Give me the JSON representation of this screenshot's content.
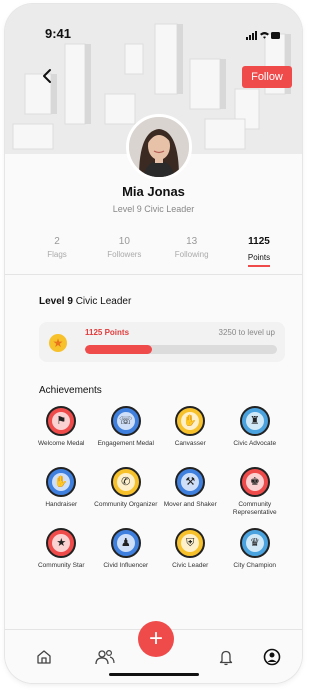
{
  "status_bar": {
    "time": "9:41"
  },
  "header": {
    "follow_label": "Follow"
  },
  "profile": {
    "name": "Mia Jonas",
    "level_title": "Level 9 Civic Leader"
  },
  "stats": [
    {
      "value": "2",
      "label": "Flags"
    },
    {
      "value": "10",
      "label": "Followers"
    },
    {
      "value": "13",
      "label": "Following"
    },
    {
      "value": "1125",
      "label": "Points"
    }
  ],
  "level_section": {
    "title_bold": "Level 9",
    "title_rest": " Civic Leader",
    "points_text": "1125 Points",
    "level_up_text": "3250 to level up",
    "progress_fraction": 0.35
  },
  "achievements": {
    "title": "Achievements",
    "items": [
      {
        "label": "Welcome Medal",
        "icon": "flag-icon",
        "color": "#ef4b4b"
      },
      {
        "label": "Engagement Medal",
        "icon": "phone-icon",
        "color": "#3f7fdd"
      },
      {
        "label": "Canvasser",
        "icon": "handshake-icon",
        "color": "#f7c12c"
      },
      {
        "label": "Civic Advocate",
        "icon": "podium-icon",
        "color": "#4aa3df"
      },
      {
        "label": "Handraiser",
        "icon": "hand-icon",
        "color": "#3f7fdd"
      },
      {
        "label": "Community Organizer",
        "icon": "megaphone-icon",
        "color": "#f7c12c"
      },
      {
        "label": "Mover and Shaker",
        "icon": "hammer-icon",
        "color": "#3f7fdd"
      },
      {
        "label": "Community Representative",
        "icon": "speaker-icon",
        "color": "#ef4b4b"
      },
      {
        "label": "Community Star",
        "icon": "star-icon",
        "color": "#ef4b4b"
      },
      {
        "label": "Civid Influencer",
        "icon": "person-icon",
        "color": "#3f7fdd"
      },
      {
        "label": "Civic Leader",
        "icon": "shield-icon",
        "color": "#f7c12c"
      },
      {
        "label": "City Champion",
        "icon": "trophy-icon",
        "color": "#4aa3df"
      }
    ]
  },
  "tabbar": {
    "fab_label": "+"
  },
  "colors": {
    "accent": "#ef4b4b",
    "star": "#f7c12c"
  }
}
